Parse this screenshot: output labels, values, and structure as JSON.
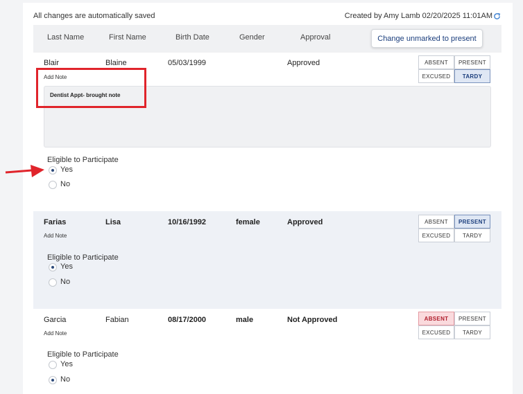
{
  "top_bar": {
    "autosave_text": "All changes are automatically saved",
    "created_by": "Created by Amy Lamb 02/20/2025 11:01AM",
    "refresh_icon": "refresh-icon"
  },
  "table": {
    "headers": [
      "Last Name",
      "First Name",
      "Birth Date",
      "Gender",
      "Approval"
    ],
    "change_button": "Change unmarked to present"
  },
  "attendance_labels": {
    "absent": "ABSENT",
    "present": "PRESENT",
    "excused": "EXCUSED",
    "tardy": "TARDY"
  },
  "students": [
    {
      "last_name": "Blair",
      "first_name": "Blaine",
      "birth_date": "05/03/1999",
      "gender": "",
      "approval": "Approved",
      "add_note": "Add Note",
      "note": "Dentist Appt- brought note",
      "attendance": "TARDY",
      "eligible_label": "Eligible to Participate",
      "yes": "Yes",
      "no": "No",
      "eligible": "Yes"
    },
    {
      "last_name": "Farias",
      "first_name": "Lisa",
      "birth_date": "10/16/1992",
      "gender": "female",
      "approval": "Approved",
      "add_note": "Add Note",
      "attendance": "PRESENT",
      "eligible_label": "Eligible to Participate",
      "yes": "Yes",
      "no": "No",
      "eligible": "Yes"
    },
    {
      "last_name": "Garcia",
      "first_name": "Fabian",
      "birth_date": "08/17/2000",
      "gender": "male",
      "approval": "Not Approved",
      "add_note": "Add Note",
      "attendance": "ABSENT",
      "eligible_label": "Eligible to Participate",
      "yes": "Yes",
      "no": "No",
      "eligible": "No"
    }
  ],
  "colors": {
    "accent": "#1a3d7c",
    "annotation_red": "#e0242b",
    "absent_bg": "#fadadd",
    "selected_bg": "#dfe7f4"
  }
}
